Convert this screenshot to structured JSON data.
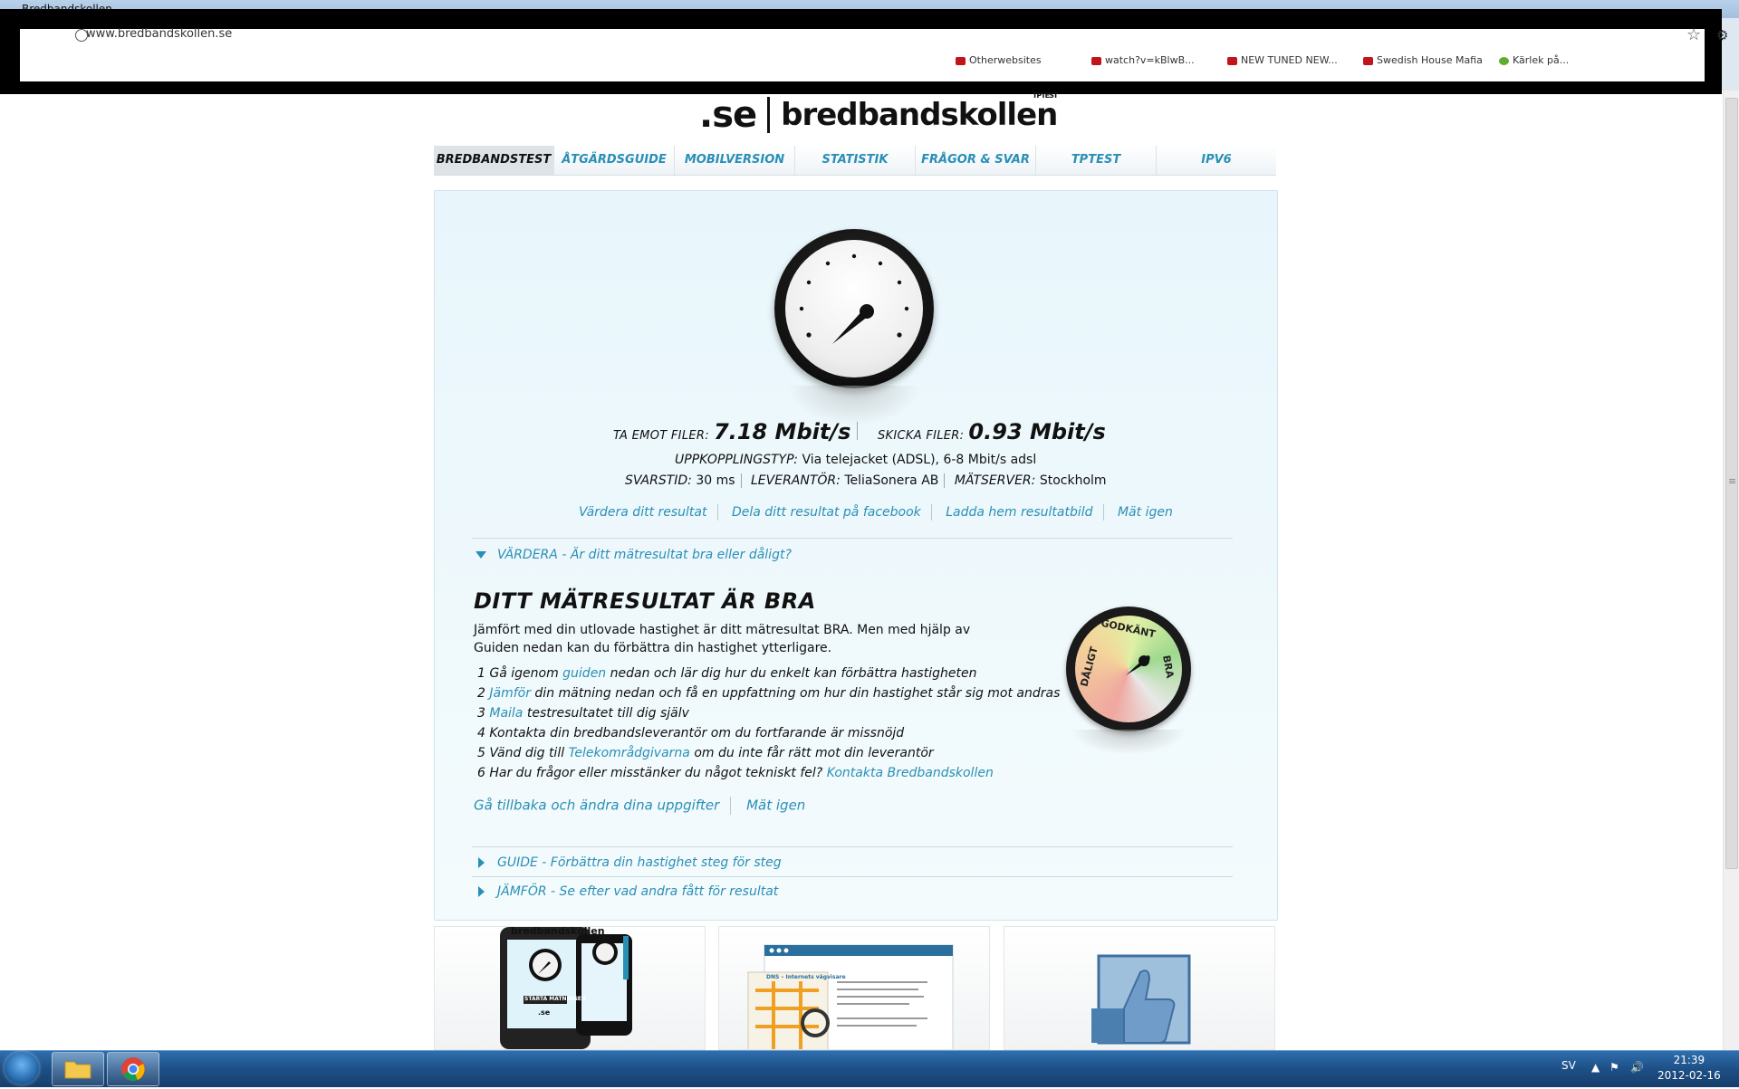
{
  "browser": {
    "tab_title": "Bredbandskollen",
    "url": "www.bredbandskollen.se",
    "bookmarks": [
      "Otherwebsites",
      "watch?v=kBlwB...",
      "NEW TUNED NEW...",
      "Swedish House Mafia",
      "Kärlek på..."
    ]
  },
  "site": {
    "logo_se": ".se",
    "logo_name": "bredbandskollen",
    "logo_tptest": "TPTEST"
  },
  "nav": {
    "tabs": [
      {
        "label": "BREDBANDSTEST",
        "active": true
      },
      {
        "label": "ÅTGÄRDSGUIDE",
        "active": false
      },
      {
        "label": "MOBILVERSION",
        "active": false
      },
      {
        "label": "STATISTIK",
        "active": false
      },
      {
        "label": "FRÅGOR & SVAR",
        "active": false
      },
      {
        "label": "TPTEST",
        "active": false
      },
      {
        "label": "IPV6",
        "active": false
      }
    ]
  },
  "result": {
    "download_label": "TA EMOT FILER:",
    "download_value": "7.18 Mbit/s",
    "upload_label": "SKICKA FILER:",
    "upload_value": "0.93 Mbit/s",
    "connection_label": "UPPKOPPLINGSTYP:",
    "connection_value": "Via telejacket (ADSL), 6-8 Mbit/s adsl",
    "latency_label": "SVARSTID:",
    "latency_value": "30 ms",
    "provider_label": "LEVERANTÖR:",
    "provider_value": "TeliaSonera AB",
    "server_label": "MÄTSERVER:",
    "server_value": "Stockholm"
  },
  "actions": {
    "rate": "Värdera ditt resultat",
    "share_facebook": "Dela ditt resultat på facebook",
    "download_image": "Ladda hem resultatbild",
    "measure_again": "Mät igen"
  },
  "rate_section": {
    "header": "VÄRDERA - Är ditt mätresultat bra eller dåligt?",
    "title": "DITT MÄTRESULTAT ÄR BRA",
    "description": "Jämfört med din utlovade hastighet är ditt mätresultat BRA. Men med hjälp av Guiden nedan kan du förbättra din hastighet ytterligare.",
    "steps": [
      {
        "pre": "1 Gå igenom ",
        "link": "guiden",
        "post": " nedan och lär dig hur du enkelt kan förbättra hastigheten"
      },
      {
        "pre": "2 ",
        "link": "Jämför",
        "post": " din mätning nedan och få en uppfattning om hur din hastighet står sig mot andras"
      },
      {
        "pre": "3 ",
        "link": "Maila",
        "post": " testresultatet till dig själv"
      },
      {
        "pre": "4 Kontakta din bredbandsleverantör om du fortfarande är missnöjd",
        "link": "",
        "post": ""
      },
      {
        "pre": "5 Vänd dig till ",
        "link": "Telekområdgivarna",
        "post": " om du inte får rätt mot din leverantör"
      },
      {
        "pre": "6 Har du frågor eller misstänker du något tekniskt fel? ",
        "link": "Kontakta Bredbandskollen",
        "post": ""
      }
    ],
    "back_link": "Gå tillbaka och ändra dina uppgifter",
    "measure_again": "Mät igen",
    "rating_labels": {
      "bad": "DÅLIGT",
      "ok": "GODKÄNT",
      "good": "BRA"
    },
    "rating_level": "BRA"
  },
  "collapsed_sections": {
    "guide": "GUIDE - Förbättra din hastighet steg för steg",
    "compare": "JÄMFÖR - Se efter vad andra fått för resultat"
  },
  "promo": {
    "mobile_brand": "bredbandskollen",
    "mobile_button": "STARTA MÄTNINGEN",
    "mobile_logo": ".se",
    "doc_title": "DNS – Internets vägvisare"
  },
  "taskbar": {
    "language": "SV",
    "time": "21:39",
    "date": "2012-02-16"
  },
  "colors": {
    "link": "#2a8fb6",
    "panel": "#e8f6fb",
    "taskbar": "#1d4f86"
  }
}
